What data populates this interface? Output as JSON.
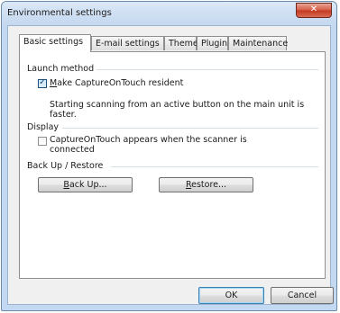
{
  "window": {
    "title": "Environmental settings"
  },
  "tabs": [
    {
      "label": "Basic settings",
      "active": true
    },
    {
      "label": "E-mail settings",
      "active": false
    },
    {
      "label": "Theme",
      "active": false
    },
    {
      "label": "Plugin",
      "active": false
    },
    {
      "label": "Maintenance",
      "active": false
    }
  ],
  "launch_method": {
    "title": "Launch method",
    "resident_checkbox": {
      "label_hotkey": "M",
      "label_rest": "ake CaptureOnTouch resident",
      "checked": true
    },
    "description_line1": "Starting scanning from an active button on the main unit is",
    "description_line2": "faster."
  },
  "display": {
    "title": "Display",
    "appears_checkbox": {
      "label_line1": "CaptureOnTouch appears when the scanner is",
      "label_line2": "connected",
      "checked": false
    }
  },
  "backup_restore": {
    "title": "Back Up / Restore",
    "backup_button": {
      "hotkey": "B",
      "rest": "ack Up..."
    },
    "restore_button": {
      "hotkey": "R",
      "rest": "estore..."
    }
  },
  "footer": {
    "ok_label": "OK",
    "cancel_label": "Cancel"
  },
  "icons": {
    "close": "close-icon",
    "check": "checkmark-icon"
  },
  "colors": {
    "title_bar": "#c4d8ef",
    "close_button": "#c2391f",
    "checkbox_checked": "#1c5180"
  }
}
